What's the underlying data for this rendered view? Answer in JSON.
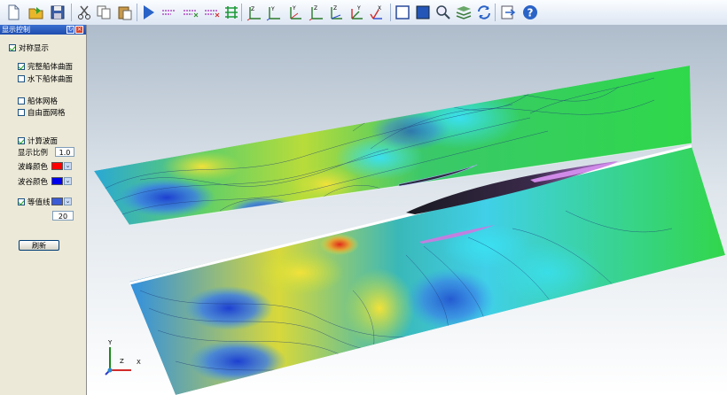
{
  "panel": {
    "title": "显示控制",
    "symmetric": {
      "label": "对称显示",
      "checked": true
    },
    "full_hull": {
      "label": "完整船体曲面",
      "checked": true
    },
    "underwater_hull": {
      "label": "水下船体曲面",
      "checked": false
    },
    "hull_mesh": {
      "label": "船体网格",
      "checked": false
    },
    "free_surface_mesh": {
      "label": "自由面网格",
      "checked": false
    },
    "wave_surface": {
      "label": "计算波面",
      "checked": true
    },
    "scale": {
      "label": "显示比例",
      "value": "1.0"
    },
    "crest_color": {
      "label": "波峰颜色",
      "color": "#ff0000"
    },
    "trough_color": {
      "label": "波谷颜色",
      "color": "#0000ee"
    },
    "contours": {
      "label": "等值线",
      "checked": true,
      "color": "#3b5bd6",
      "count": "20"
    },
    "refresh_label": "刷新"
  },
  "axes": {
    "y": "Y",
    "z": "Z",
    "x": "X"
  },
  "toolbar": {
    "icons": [
      "new-file-icon",
      "open-folder-icon",
      "save-icon",
      "cut-icon",
      "copy-icon",
      "paste-icon",
      "run-icon",
      "arrow-tool-1-icon",
      "arrow-tool-2-icon",
      "arrow-tool-3-icon",
      "grid-tool-icon",
      "axis-view-1-icon",
      "axis-view-2-icon",
      "axis-view-3-icon",
      "axis-view-4-icon",
      "axis-view-5-icon",
      "axis-view-6-icon",
      "axis-view-7-icon",
      "frame-icon",
      "fill-icon",
      "zoom-icon",
      "layers-icon",
      "refresh-icon",
      "export-icon",
      "help-icon"
    ],
    "axis_letters": [
      "Z",
      "Y",
      "Y",
      "Z",
      "Z",
      "Y",
      "X"
    ]
  }
}
